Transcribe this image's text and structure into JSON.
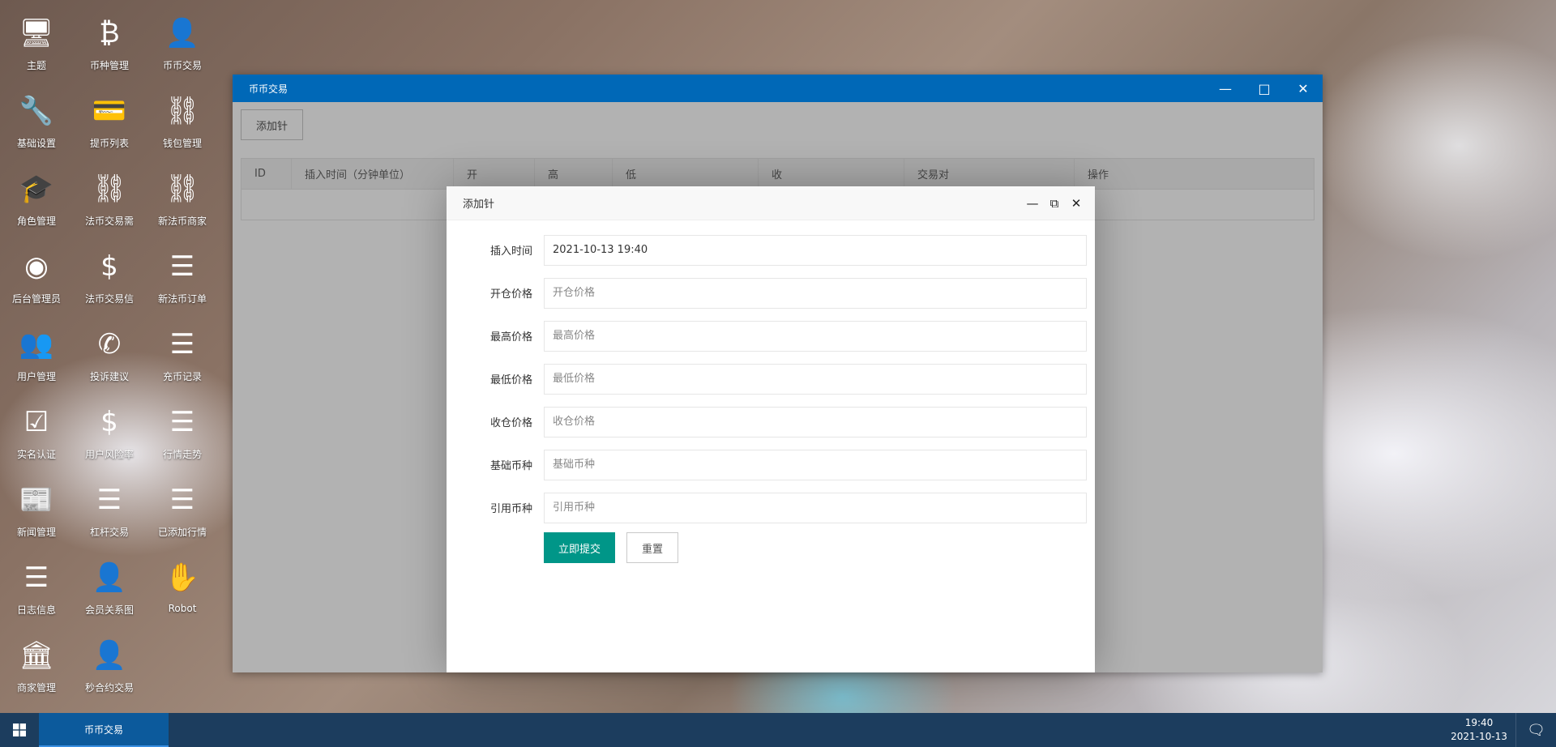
{
  "desktop_icons": [
    {
      "label": "主题",
      "icon": "monitor-icon",
      "glyph": "🖥"
    },
    {
      "label": "币种管理",
      "icon": "bitcoin-icon",
      "glyph": "₿"
    },
    {
      "label": "币币交易",
      "icon": "user-plus-icon",
      "glyph": "👤"
    },
    {
      "label": "基础设置",
      "icon": "wrench-icon",
      "glyph": "🔧"
    },
    {
      "label": "提币列表",
      "icon": "credit-card-icon",
      "glyph": "💳"
    },
    {
      "label": "钱包管理",
      "icon": "link-icon",
      "glyph": "⛓"
    },
    {
      "label": "角色管理",
      "icon": "graduation-cap-icon",
      "glyph": "🎓"
    },
    {
      "label": "法币交易需",
      "icon": "link-icon",
      "glyph": "⛓"
    },
    {
      "label": "新法币商家",
      "icon": "link-icon",
      "glyph": "⛓"
    },
    {
      "label": "后台管理员",
      "icon": "user-circle-icon",
      "glyph": "◉"
    },
    {
      "label": "法币交易信",
      "icon": "dollar-icon",
      "glyph": "$"
    },
    {
      "label": "新法币订单",
      "icon": "list-icon",
      "glyph": "☰"
    },
    {
      "label": "用户管理",
      "icon": "users-icon",
      "glyph": "👥"
    },
    {
      "label": "投诉建议",
      "icon": "phone-icon",
      "glyph": "✆"
    },
    {
      "label": "充币记录",
      "icon": "list-icon",
      "glyph": "☰"
    },
    {
      "label": "实名认证",
      "icon": "checkbox-icon",
      "glyph": "☑"
    },
    {
      "label": "用户风险率",
      "icon": "dollar-icon",
      "glyph": "$"
    },
    {
      "label": "行情走势",
      "icon": "list-icon",
      "glyph": "☰"
    },
    {
      "label": "新闻管理",
      "icon": "newspaper-icon",
      "glyph": "📰"
    },
    {
      "label": "杠杆交易",
      "icon": "list-icon",
      "glyph": "☰"
    },
    {
      "label": "已添加行情",
      "icon": "list-icon",
      "glyph": "☰"
    },
    {
      "label": "日志信息",
      "icon": "list-icon",
      "glyph": "☰"
    },
    {
      "label": "会员关系图",
      "icon": "user-plus-icon",
      "glyph": "👤"
    },
    {
      "label": "Robot",
      "icon": "hand-icon",
      "glyph": "✋"
    },
    {
      "label": "商家管理",
      "icon": "bank-icon",
      "glyph": "🏛"
    },
    {
      "label": "秒合约交易",
      "icon": "user-plus-icon",
      "glyph": "👤"
    }
  ],
  "main_window": {
    "title": "币币交易",
    "add_button": "添加针",
    "columns": [
      "ID",
      "插入时间（分钟单位）",
      "开",
      "高",
      "低",
      "收",
      "交易对",
      "操作"
    ]
  },
  "dialog": {
    "title": "添加针",
    "fields": [
      {
        "label": "插入时间",
        "value": "2021-10-13 19:40",
        "placeholder": ""
      },
      {
        "label": "开仓价格",
        "value": "",
        "placeholder": "开仓价格"
      },
      {
        "label": "最高价格",
        "value": "",
        "placeholder": "最高价格"
      },
      {
        "label": "最低价格",
        "value": "",
        "placeholder": "最低价格"
      },
      {
        "label": "收仓价格",
        "value": "",
        "placeholder": "收仓价格"
      },
      {
        "label": "基础币种",
        "value": "",
        "placeholder": "基础币种"
      },
      {
        "label": "引用币种",
        "value": "",
        "placeholder": "引用币种"
      }
    ],
    "submit": "立即提交",
    "reset": "重置"
  },
  "taskbar": {
    "active_task": "币币交易",
    "time": "19:40",
    "date": "2021-10-13"
  },
  "colors": {
    "titlebar": "#0068b7",
    "primary": "#009688",
    "taskbar": "#1c3d5e"
  }
}
